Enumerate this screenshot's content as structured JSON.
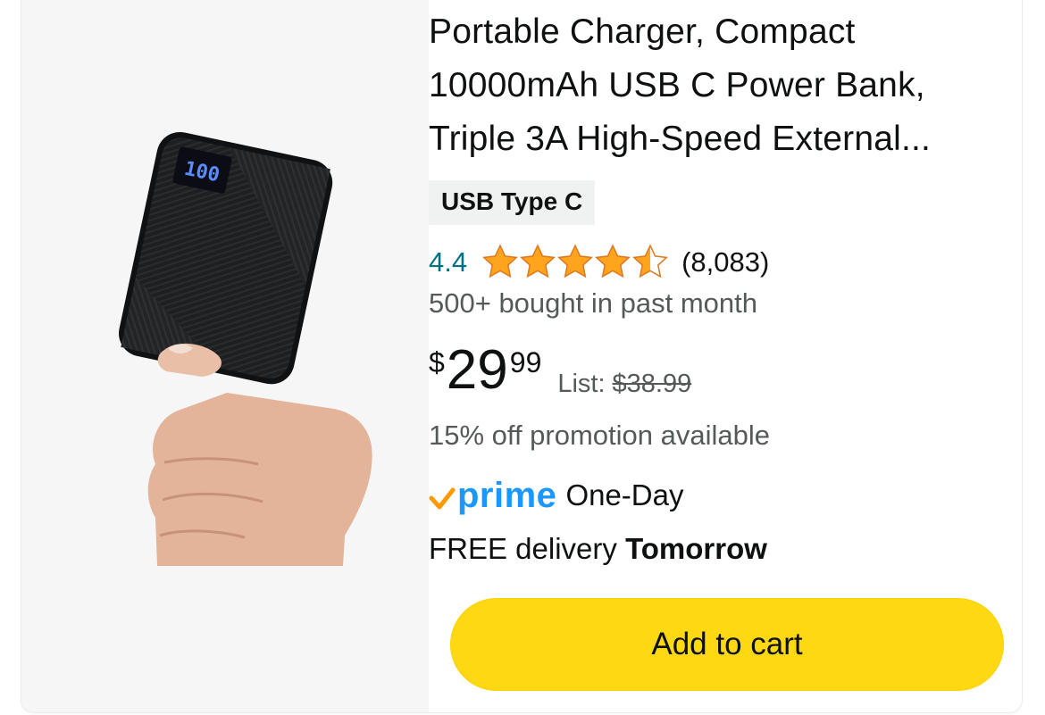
{
  "product": {
    "title_lines": [
      "Portable Charger, Compact",
      "10000mAh USB C Power Bank,",
      "Triple 3A High-Speed External..."
    ],
    "variant": "USB Type C",
    "rating": "4.4",
    "stars_filled": 4.4,
    "review_count": "(8,083)",
    "bought_text": "500+ bought in past month",
    "price": {
      "symbol": "$",
      "whole": "29",
      "fraction": "99",
      "list_label": "List:",
      "list_price": "$38.99"
    },
    "promotion": "15% off promotion available",
    "prime": {
      "logo_text": "prime",
      "speed": "One-Day"
    },
    "delivery": {
      "prefix": "FREE delivery",
      "date": "Tomorrow"
    },
    "add_to_cart_label": "Add to cart",
    "display_reading": "100"
  },
  "colors": {
    "star": "#ffa41c",
    "link": "#007185",
    "prime_blue": "#1a98ff",
    "prime_check": "#ff9900",
    "button": "#ffd814",
    "badge_bg": "#f0f2f2",
    "muted_text": "#565959"
  },
  "icons": {
    "rating": "star-icon",
    "prime": "prime-check-icon"
  }
}
